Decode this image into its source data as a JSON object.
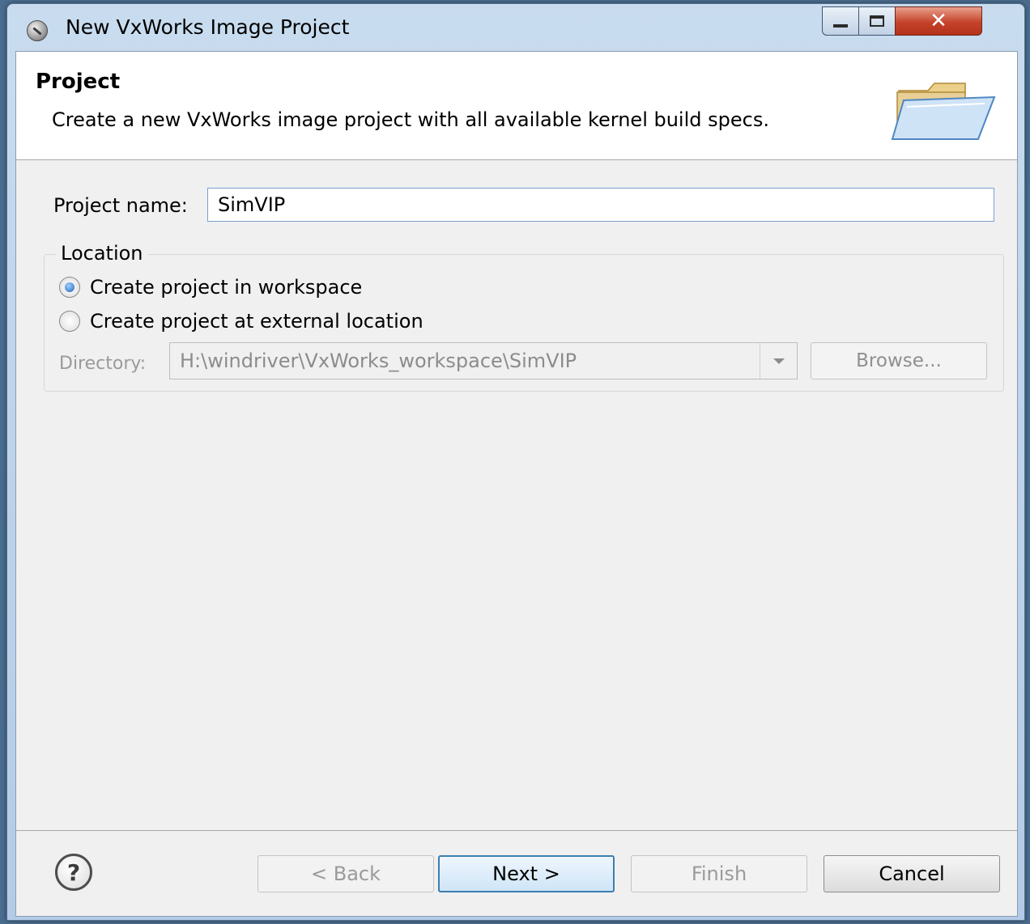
{
  "window": {
    "title": "New VxWorks Image Project",
    "close_glyph": "✕"
  },
  "banner": {
    "title": "Project",
    "description": "Create a new VxWorks image project with all available kernel build specs."
  },
  "form": {
    "project_name_label": "Project name:",
    "project_name_value": "SimVIP"
  },
  "location": {
    "legend": "Location",
    "options": [
      {
        "label": "Create project in workspace",
        "selected": true
      },
      {
        "label": "Create project at external location",
        "selected": false
      }
    ],
    "directory_label": "Directory:",
    "directory_value": "H:\\windriver\\VxWorks_workspace\\SimVIP",
    "browse_label": "Browse..."
  },
  "footer": {
    "help_glyph": "?",
    "back_label": "< Back",
    "next_label": "Next >",
    "finish_label": "Finish",
    "cancel_label": "Cancel"
  },
  "colors": {
    "accent": "#3c7fb1",
    "radio_selected": "#1e62b8",
    "close_button": "#c4432a"
  }
}
